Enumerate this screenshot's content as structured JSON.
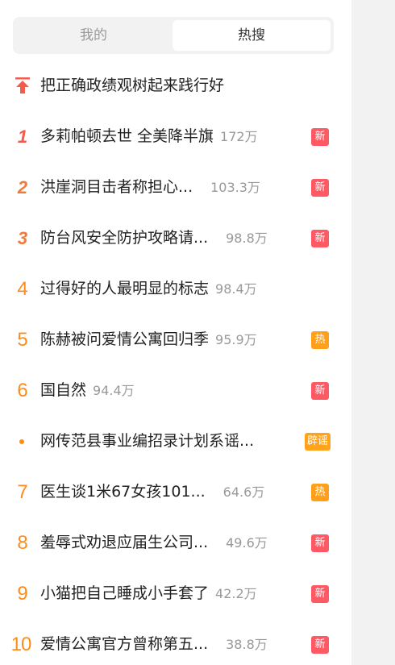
{
  "tabs": {
    "mine": "我的",
    "hot": "热搜"
  },
  "pinned": {
    "title": "把正确政绩观树起来践行好"
  },
  "items": [
    {
      "rank": "1",
      "title": "多莉帕顿去世 全美降半旗",
      "heat": "172万",
      "badge": "新"
    },
    {
      "rank": "2",
      "title": "洪崖洞目击者称担心...",
      "heat": "103.3万",
      "badge": "新"
    },
    {
      "rank": "3",
      "title": "防台风安全防护攻略请...",
      "heat": "98.8万",
      "badge": "新"
    },
    {
      "rank": "4",
      "title": "过得好的人最明显的标志",
      "heat": "98.4万",
      "badge": ""
    },
    {
      "rank": "5",
      "title": "陈赫被问爱情公寓回归季",
      "heat": "95.9万",
      "badge": "热"
    },
    {
      "rank": "6",
      "title": "国自然",
      "heat": "94.4万",
      "badge": "新"
    },
    {
      "rank": "",
      "title": "网传范县事业编招录计划系谣...",
      "heat": "",
      "badge": "辟谣"
    },
    {
      "rank": "7",
      "title": "医生谈1米67女孩101...",
      "heat": "64.6万",
      "badge": "热"
    },
    {
      "rank": "8",
      "title": "羞辱式劝退应届生公司...",
      "heat": "49.6万",
      "badge": "新"
    },
    {
      "rank": "9",
      "title": "小猫把自己睡成小手套了",
      "heat": "42.2万",
      "badge": "新"
    },
    {
      "rank": "10",
      "title": "爱情公寓官方曾称第五...",
      "heat": "38.8万",
      "badge": "新"
    }
  ],
  "colors": {
    "new_badge": "#ff5a64",
    "hot_badge": "#ff9f1a",
    "top_rank": "#f25c4a",
    "rank": "#ff8c1a"
  }
}
